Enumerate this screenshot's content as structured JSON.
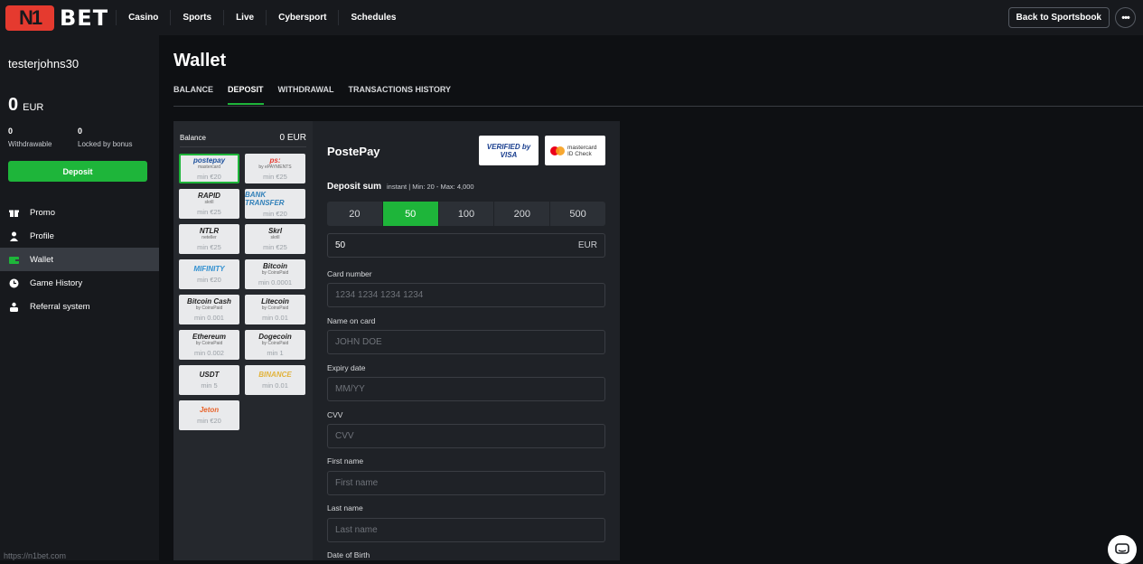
{
  "header": {
    "logo_mark": "N1",
    "logo_text": "BET",
    "nav": [
      "Casino",
      "Sports",
      "Live",
      "Cybersport",
      "Schedules"
    ],
    "back_label": "Back to Sportsbook",
    "more_label": "•••"
  },
  "sidebar": {
    "username": "testerjohns30",
    "balance": "0",
    "currency": "EUR",
    "withdrawable_value": "0",
    "withdrawable_label": "Withdrawable",
    "locked_value": "0",
    "locked_label": "Locked by bonus",
    "deposit_label": "Deposit",
    "menu": [
      {
        "label": "Promo",
        "icon": "gift-icon"
      },
      {
        "label": "Profile",
        "icon": "user-icon"
      },
      {
        "label": "Wallet",
        "icon": "wallet-icon"
      },
      {
        "label": "Game History",
        "icon": "clock-icon"
      },
      {
        "label": "Referral system",
        "icon": "referral-icon"
      }
    ],
    "status_url": "https://n1bet.com"
  },
  "main": {
    "title": "Wallet",
    "tabs": [
      "BALANCE",
      "DEPOSIT",
      "WITHDRAWAL",
      "TRANSACTIONS HISTORY"
    ],
    "active_tab": "DEPOSIT"
  },
  "methods": {
    "balance_label": "Balance",
    "balance_value": "0 EUR",
    "items": [
      {
        "name": "postepay",
        "sub": "mastercard",
        "min": "min €20",
        "color": "#1b4f9c"
      },
      {
        "name": "ps:",
        "sub": "by ePAYMENTS",
        "min": "min €25",
        "color": "#e53a2f"
      },
      {
        "name": "RAPID",
        "sub": "skrill",
        "min": "min €25",
        "color": "#222222"
      },
      {
        "name": "BANK TRANSFER",
        "sub": "",
        "min": "min €20",
        "color": "#2f7fb8"
      },
      {
        "name": "NTLR",
        "sub": "neteller",
        "min": "min €25",
        "color": "#222222"
      },
      {
        "name": "Skrl",
        "sub": "skrill",
        "min": "min €25",
        "color": "#222222"
      },
      {
        "name": "MIFINITY",
        "sub": "",
        "min": "min €20",
        "color": "#2f8fd0"
      },
      {
        "name": "Bitcoin",
        "sub": "by CoinsPaid",
        "min": "min 0.0001",
        "color": "#222222"
      },
      {
        "name": "Bitcoin Cash",
        "sub": "by CoinsPaid",
        "min": "min 0.001",
        "color": "#222222"
      },
      {
        "name": "Litecoin",
        "sub": "by CoinsPaid",
        "min": "min 0.01",
        "color": "#222222"
      },
      {
        "name": "Ethereum",
        "sub": "by CoinsPaid",
        "min": "min 0.002",
        "color": "#222222"
      },
      {
        "name": "Dogecoin",
        "sub": "by CoinsPaid",
        "min": "min 1",
        "color": "#222222"
      },
      {
        "name": "USDT",
        "sub": "",
        "min": "min 5",
        "color": "#222222"
      },
      {
        "name": "BINANCE",
        "sub": "",
        "min": "min 0.01",
        "color": "#e1b23a"
      },
      {
        "name": "Jeton",
        "sub": "",
        "min": "min €20",
        "color": "#e8642c"
      }
    ]
  },
  "form": {
    "title": "PostePay",
    "badge_visa": "VERIFIED by VISA",
    "badge_mc": "mastercard ID Check",
    "deposit_sum_label": "Deposit sum",
    "deposit_sum_info": "instant | Min: 20 - Max: 4,000",
    "amounts": [
      "20",
      "50",
      "100",
      "200",
      "500"
    ],
    "active_amount": "50",
    "amount_value": "50",
    "amount_currency": "EUR",
    "fields": [
      {
        "label": "Card number",
        "placeholder": "1234 1234 1234 1234"
      },
      {
        "label": "Name on card",
        "placeholder": "JOHN DOE"
      },
      {
        "label": "Expiry date",
        "placeholder": "MM/YY"
      },
      {
        "label": "CVV",
        "placeholder": "CVV"
      },
      {
        "label": "First name",
        "placeholder": "First name"
      },
      {
        "label": "Last name",
        "placeholder": "Last name"
      },
      {
        "label": "Date of Birth",
        "placeholder": ""
      }
    ]
  },
  "colors": {
    "accent": "#1eb53a",
    "brand_red": "#e53a2f"
  }
}
